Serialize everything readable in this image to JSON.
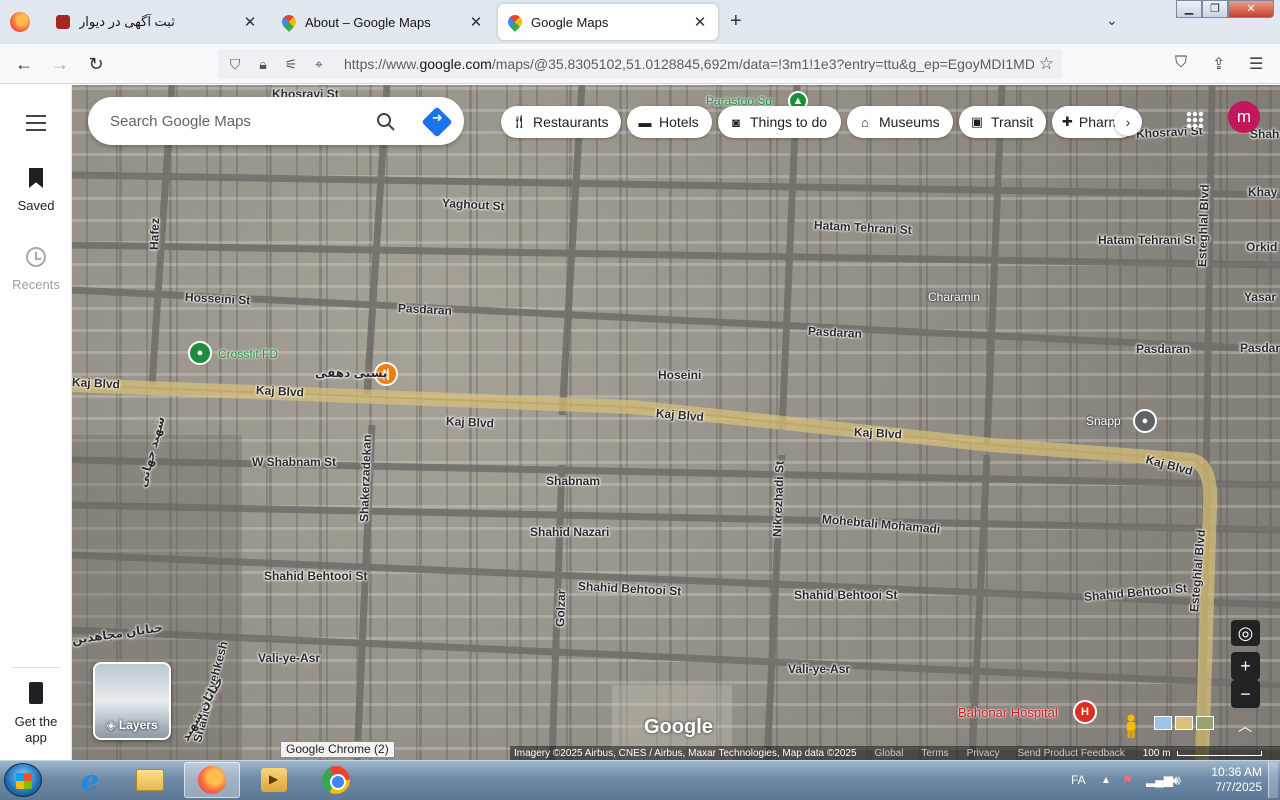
{
  "browser": {
    "tabs": [
      {
        "title": "ثبت آگهی در دیوار",
        "favicon": "divar-icon",
        "active": false
      },
      {
        "title": "About – Google Maps",
        "favicon": "google-maps-icon",
        "active": false
      },
      {
        "title": "Google Maps",
        "favicon": "google-maps-icon",
        "active": true
      }
    ],
    "new_tab_label": "+",
    "url_prefix": "https://www.",
    "url_host": "google.com",
    "url_rest": "/maps/@35.8305102,51.0128845,692m/data=!3m1!1e3?entry=ttu&g_ep=EgoyMDI1MD"
  },
  "maps": {
    "search": {
      "placeholder": "Search Google Maps"
    },
    "rail": {
      "saved": "Saved",
      "recents": "Recents",
      "get_app": "Get the app"
    },
    "chips": [
      "Restaurants",
      "Hotels",
      "Things to do",
      "Museums",
      "Transit",
      "Pharmacies"
    ],
    "avatar_letter": "m",
    "layers_label": "Layers",
    "logo": "Google",
    "attribution": {
      "imagery": "Imagery ©2025 Airbus, CNES / Airbus, Maxar Technologies, Map data ©2025",
      "global": "Global",
      "terms": "Terms",
      "privacy": "Privacy",
      "feedback": "Send Product Feedback",
      "scale": "100 m"
    },
    "places": {
      "crossfit": "Crossfit FD",
      "pasti": "پستی دهقی",
      "snapp": "Snapp",
      "hospital": "Bahonar Hospital",
      "parastoo": "Parastoo Sq"
    },
    "streets": {
      "khosravi_top": "Khosravi St",
      "khosravi_right": "Khosravi St",
      "yaghout": "Yaghout St",
      "hatam1": "Hatam Tehrani St",
      "hatam2": "Hatam Tehrani St",
      "hafez": "Hafez",
      "hosseini": "Hosseini St",
      "pasdaran1": "Pasdaran",
      "pasdaran2": "Pasdaran",
      "pasdaran3": "Pasdaran",
      "pasdaran4": "Pasdar",
      "charamin": "Charamin",
      "hoseini": "Hoseini",
      "kaj_left": "Kaj Blvd",
      "kaj1": "Kaj Blvd",
      "kaj2": "Kaj Blvd",
      "kaj3": "Kaj Blvd",
      "kaj4": "Kaj Blvd",
      "kaj5": "Kaj Blvd",
      "w_shabnam": "W Shabnam St",
      "shabnam": "Shabnam",
      "shakerzadekan": "Shakerzadekan",
      "nikrezhadi": "Nikrezhadi St",
      "mohebtali": "Mohebtali Mohamadi",
      "shahid_nazari": "Shahid Nazari",
      "behtooi1": "Shahid Behtooi St",
      "behtooi2": "Shahid Behtooi St",
      "behtooi3": "Shahid Behtooi St",
      "behtooi4": "Shahid Behtooi St",
      "golzar": "Golzar",
      "vali1": "Vali-ye-Asr",
      "vali2": "Vali-ye-Asr",
      "esteghlal1": "Esteghlal Blvd",
      "esteghlal2": "Esteghlal Blvd",
      "givehkesh": "Shahid Givehkesh",
      "khay": "Khay",
      "orkid": "Orkid",
      "yasar": "Yasar",
      "shah": "Shah",
      "fa_left": "خیابان مجاهدین",
      "fa_left2": "شهید جهانی",
      "fa_bottom": "خیابان شهید"
    }
  },
  "os": {
    "tooltip": "Google Chrome (2)",
    "lang": "FA",
    "time": "10:36 AM",
    "date": "7/7/2025"
  },
  "colors": {
    "avatar": "#c2185b",
    "accent": "#1a73e8",
    "road_highlight": "#d9c27a"
  }
}
